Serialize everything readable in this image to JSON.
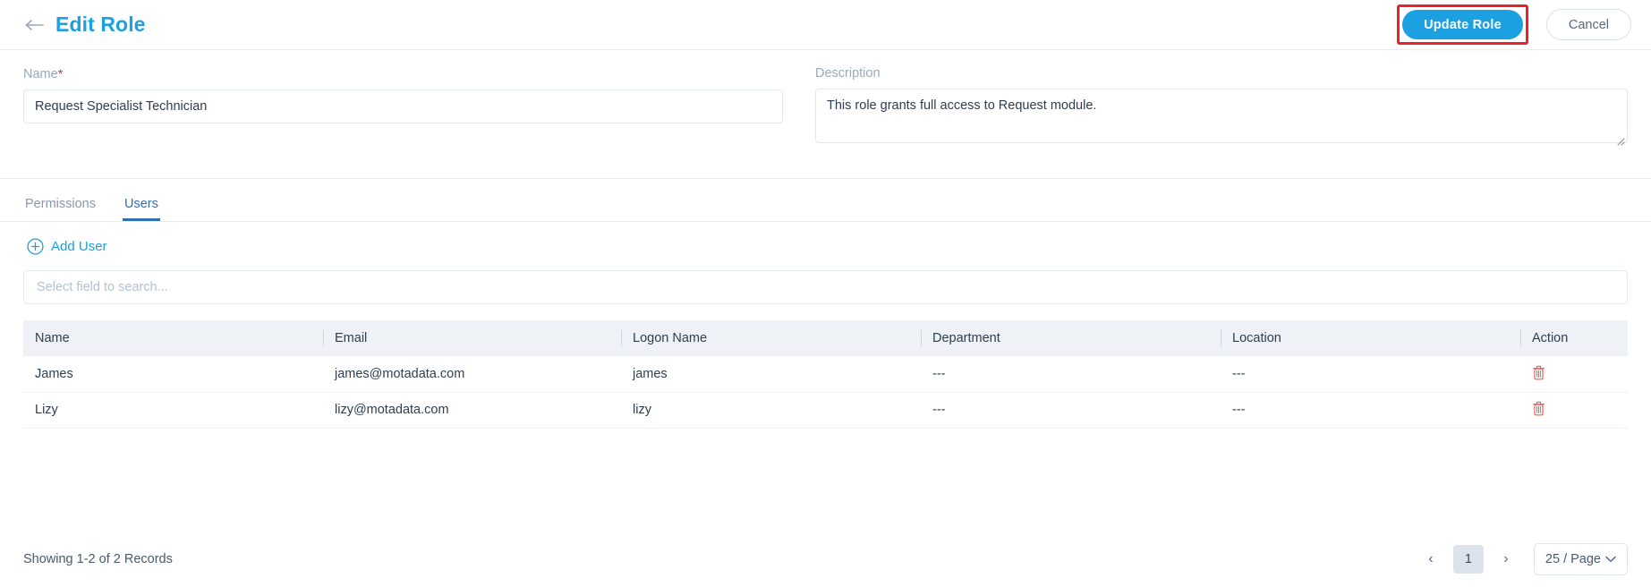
{
  "header": {
    "back_icon": "arrow-left-icon",
    "title": "Edit Role",
    "update_label": "Update Role",
    "cancel_label": "Cancel",
    "highlight_color": "#e8232a",
    "primary_color": "#1ba0e2"
  },
  "form": {
    "name": {
      "label": "Name",
      "required_marker": "*",
      "value": "Request Specialist Technician",
      "placeholder": ""
    },
    "description": {
      "label": "Description",
      "value": "This role grants full access to Request module.",
      "placeholder": ""
    }
  },
  "tabs": [
    {
      "label": "Permissions",
      "active": false
    },
    {
      "label": "Users",
      "active": true
    }
  ],
  "toolbar": {
    "add_user_label": "Add User",
    "add_user_icon": "plus-circle-icon"
  },
  "search": {
    "placeholder": "Select field to search...",
    "value": ""
  },
  "table": {
    "columns": [
      "Name",
      "Email",
      "Logon Name",
      "Department",
      "Location",
      "Action"
    ],
    "rows": [
      {
        "name": "James",
        "email": "james@motadata.com",
        "logon_name": "james",
        "department": "---",
        "location": "---",
        "action_icon": "trash-icon"
      },
      {
        "name": "Lizy",
        "email": "lizy@motadata.com",
        "logon_name": "lizy",
        "department": "---",
        "location": "---",
        "action_icon": "trash-icon"
      }
    ]
  },
  "footer": {
    "records_text": "Showing 1-2 of 2 Records",
    "prev_label": "‹",
    "next_label": "›",
    "current_page": "1",
    "page_size_label": "25 / Page"
  }
}
